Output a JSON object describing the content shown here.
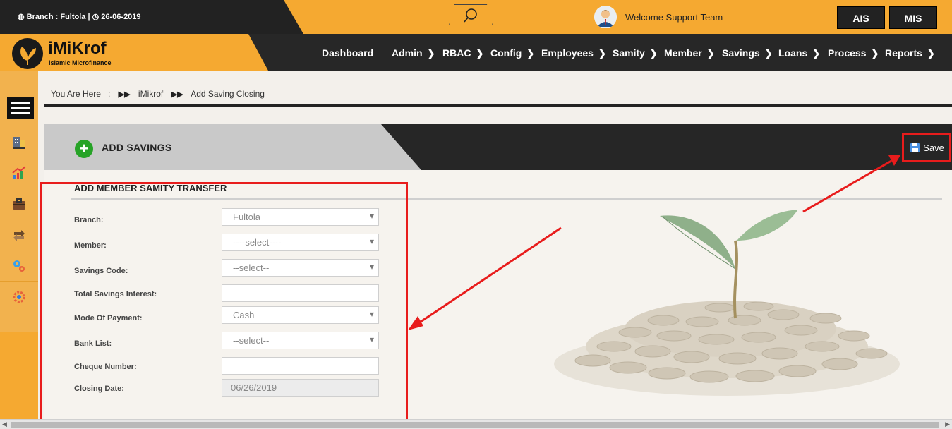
{
  "topbar": {
    "branch_label": "Branch : Fultola |",
    "date": "26-06-2019",
    "welcome": "Welcome Support Team",
    "buttons": [
      "AIS",
      "MIS"
    ]
  },
  "logo": {
    "title": "iMiKrof",
    "subtitle": "Islamic Microfinance"
  },
  "nav": [
    "Dashboard",
    "Admin",
    "RBAC",
    "Config",
    "Employees",
    "Samity",
    "Member",
    "Savings",
    "Loans",
    "Process",
    "Reports"
  ],
  "sidebar_icons": [
    "building-icon",
    "chart-icon",
    "briefcase-icon",
    "transfer-icon",
    "gears-icon",
    "settings-icon"
  ],
  "breadcrumb": {
    "you_are_here": "You Are Here",
    "colon": ":",
    "home": "iMikrof",
    "current": "Add Saving Closing"
  },
  "panel": {
    "title": "ADD SAVINGS",
    "save_label": "Save"
  },
  "form": {
    "section_title": "ADD MEMBER SAMITY TRANSFER",
    "fields": [
      {
        "label": "Branch:",
        "value": "Fultola",
        "type": "select"
      },
      {
        "label": "Member:",
        "value": "----select----",
        "type": "select"
      },
      {
        "label": "Savings Code:",
        "value": "--select--",
        "type": "select"
      },
      {
        "label": "Total Savings Interest:",
        "value": "",
        "type": "text"
      },
      {
        "label": "Mode Of Payment:",
        "value": "Cash",
        "type": "select"
      },
      {
        "label": "Bank List:",
        "value": "--select--",
        "type": "select"
      },
      {
        "label": "Cheque Number:",
        "value": "",
        "type": "text"
      },
      {
        "label": "Closing Date:",
        "value": "06/26/2019",
        "type": "disabled"
      }
    ]
  },
  "colors": {
    "accent": "#f5a931",
    "dark": "#262626",
    "highlight": "#e81c1c",
    "success": "#27a327"
  }
}
